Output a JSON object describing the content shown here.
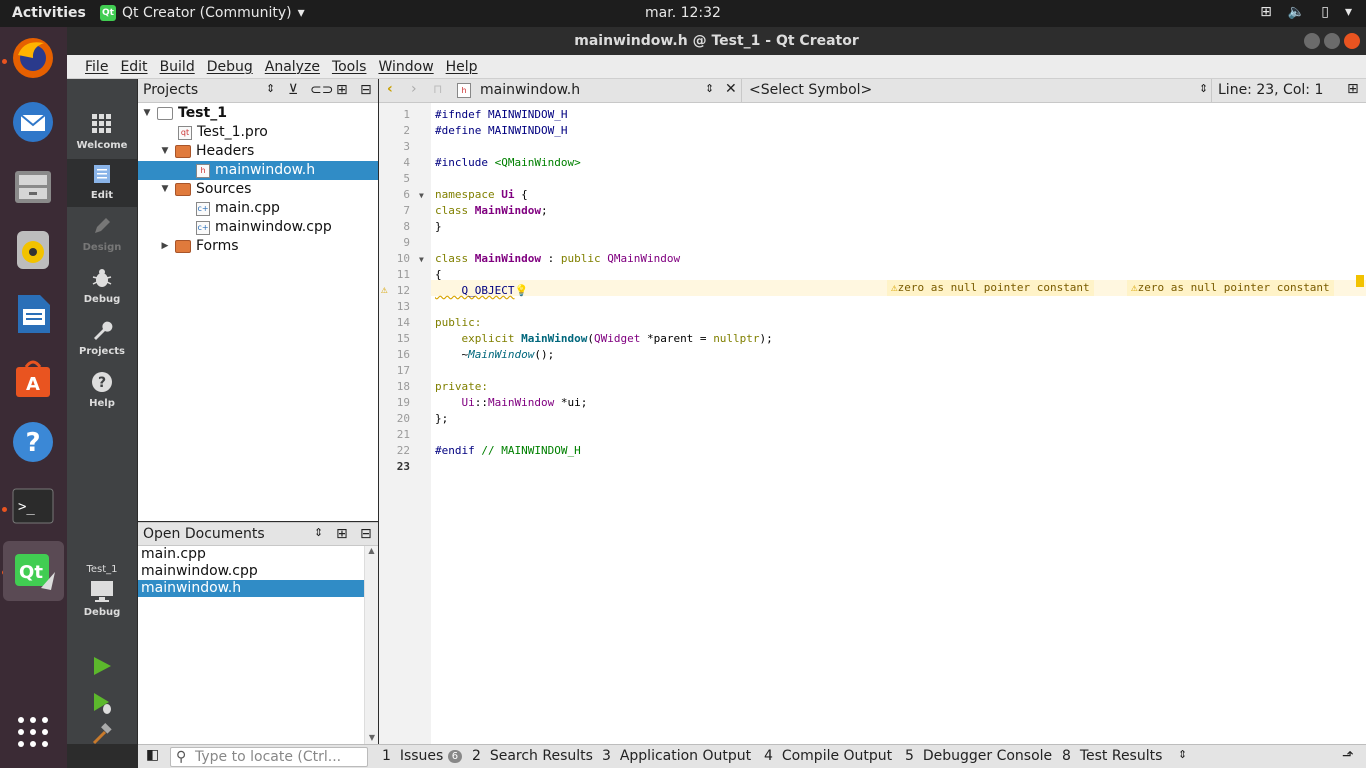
{
  "topbar": {
    "activities": "Activities",
    "app_name": "Qt Creator (Community)",
    "clock": "mar. 12:32"
  },
  "dock": {
    "items": [
      "firefox-icon",
      "thunderbird-icon",
      "files-icon",
      "rhythmbox-icon",
      "libreoffice-writer-icon",
      "software-center-icon",
      "help-icon",
      "terminal-icon",
      "qt-creator-icon"
    ]
  },
  "window": {
    "title": "mainwindow.h @ Test_1 - Qt Creator"
  },
  "menu": [
    "File",
    "Edit",
    "Build",
    "Debug",
    "Analyze",
    "Tools",
    "Window",
    "Help"
  ],
  "modes": {
    "welcome": "Welcome",
    "edit": "Edit",
    "design": "Design",
    "debug": "Debug",
    "projects": "Projects",
    "help": "Help",
    "kit_project": "Test_1",
    "kit_config": "Debug"
  },
  "projects_pane": {
    "title": "Projects",
    "tree": {
      "root": "Test_1",
      "pro": "Test_1.pro",
      "headers": "Headers",
      "header_file": "mainwindow.h",
      "sources": "Sources",
      "source_main": "main.cpp",
      "source_mw": "mainwindow.cpp",
      "forms": "Forms"
    }
  },
  "open_documents": {
    "title": "Open Documents",
    "items": [
      "main.cpp",
      "mainwindow.cpp",
      "mainwindow.h"
    ]
  },
  "editor": {
    "file_combo": "mainwindow.h",
    "symbol_combo": "<Select Symbol>",
    "position": "Line: 23, Col: 1",
    "warning_1": "zero as null pointer constant",
    "warning_2": "zero as null pointer constant",
    "line_numbers": [
      "1",
      "2",
      "3",
      "4",
      "5",
      "6",
      "7",
      "8",
      "9",
      "10",
      "11",
      "12",
      "13",
      "14",
      "15",
      "16",
      "17",
      "18",
      "19",
      "20",
      "21",
      "22",
      "23"
    ]
  },
  "code": {
    "l1a": "#ifndef",
    "l1b": " MAINWINDOW_H",
    "l2a": "#define",
    "l2b": " MAINWINDOW_H",
    "l4a": "#include",
    "l4b": " <QMainWindow>",
    "l6a": "namespace",
    "l6b": " Ui",
    "l6c": " {",
    "l7a": "class",
    "l7b": " MainWindow",
    "l7c": ";",
    "l8": "}",
    "l10a": "class",
    "l10b": " MainWindow",
    "l10c": " : ",
    "l10d": "public",
    "l10e": " QMainWindow",
    "l11": "{",
    "l12": "    Q_OBJECT",
    "l14": "public:",
    "l15a": "    explicit",
    "l15b": " MainWindow",
    "l15c": "(",
    "l15d": "QWidget",
    "l15e": " *parent = ",
    "l15f": "nullptr",
    "l15g": ");",
    "l16a": "    ~",
    "l16b": "MainWindow",
    "l16c": "();",
    "l18": "private:",
    "l19a": "    Ui",
    "l19b": "::",
    "l19c": "MainWindow",
    "l19d": " *ui;",
    "l20": "};",
    "l22a": "#endif",
    "l22b": " // MAINWINDOW_H"
  },
  "statusbar": {
    "locator_placeholder": "Type to locate (Ctrl...",
    "tabs": [
      {
        "num": "1",
        "label": "Issues",
        "badge": "6"
      },
      {
        "num": "2",
        "label": "Search Results"
      },
      {
        "num": "3",
        "label": "Application Output"
      },
      {
        "num": "4",
        "label": "Compile Output"
      },
      {
        "num": "5",
        "label": "Debugger Console"
      },
      {
        "num": "8",
        "label": "Test Results"
      }
    ]
  }
}
